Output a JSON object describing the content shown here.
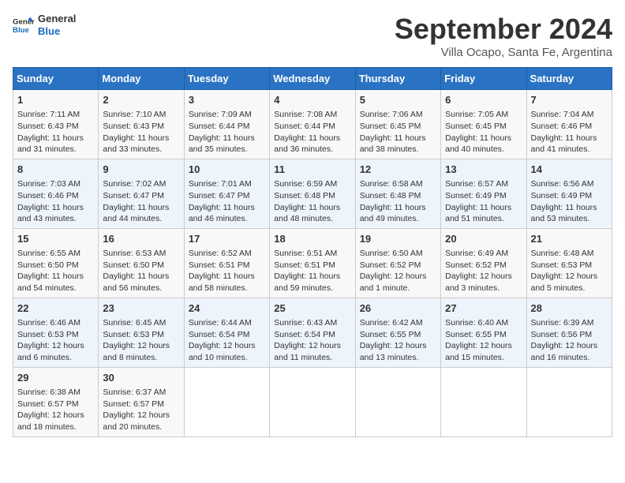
{
  "header": {
    "logo_line1": "General",
    "logo_line2": "Blue",
    "month": "September 2024",
    "location": "Villa Ocapo, Santa Fe, Argentina"
  },
  "days_of_week": [
    "Sunday",
    "Monday",
    "Tuesday",
    "Wednesday",
    "Thursday",
    "Friday",
    "Saturday"
  ],
  "weeks": [
    [
      {
        "day": "1",
        "info": "Sunrise: 7:11 AM\nSunset: 6:43 PM\nDaylight: 11 hours\nand 31 minutes."
      },
      {
        "day": "2",
        "info": "Sunrise: 7:10 AM\nSunset: 6:43 PM\nDaylight: 11 hours\nand 33 minutes."
      },
      {
        "day": "3",
        "info": "Sunrise: 7:09 AM\nSunset: 6:44 PM\nDaylight: 11 hours\nand 35 minutes."
      },
      {
        "day": "4",
        "info": "Sunrise: 7:08 AM\nSunset: 6:44 PM\nDaylight: 11 hours\nand 36 minutes."
      },
      {
        "day": "5",
        "info": "Sunrise: 7:06 AM\nSunset: 6:45 PM\nDaylight: 11 hours\nand 38 minutes."
      },
      {
        "day": "6",
        "info": "Sunrise: 7:05 AM\nSunset: 6:45 PM\nDaylight: 11 hours\nand 40 minutes."
      },
      {
        "day": "7",
        "info": "Sunrise: 7:04 AM\nSunset: 6:46 PM\nDaylight: 11 hours\nand 41 minutes."
      }
    ],
    [
      {
        "day": "8",
        "info": "Sunrise: 7:03 AM\nSunset: 6:46 PM\nDaylight: 11 hours\nand 43 minutes."
      },
      {
        "day": "9",
        "info": "Sunrise: 7:02 AM\nSunset: 6:47 PM\nDaylight: 11 hours\nand 44 minutes."
      },
      {
        "day": "10",
        "info": "Sunrise: 7:01 AM\nSunset: 6:47 PM\nDaylight: 11 hours\nand 46 minutes."
      },
      {
        "day": "11",
        "info": "Sunrise: 6:59 AM\nSunset: 6:48 PM\nDaylight: 11 hours\nand 48 minutes."
      },
      {
        "day": "12",
        "info": "Sunrise: 6:58 AM\nSunset: 6:48 PM\nDaylight: 11 hours\nand 49 minutes."
      },
      {
        "day": "13",
        "info": "Sunrise: 6:57 AM\nSunset: 6:49 PM\nDaylight: 11 hours\nand 51 minutes."
      },
      {
        "day": "14",
        "info": "Sunrise: 6:56 AM\nSunset: 6:49 PM\nDaylight: 11 hours\nand 53 minutes."
      }
    ],
    [
      {
        "day": "15",
        "info": "Sunrise: 6:55 AM\nSunset: 6:50 PM\nDaylight: 11 hours\nand 54 minutes."
      },
      {
        "day": "16",
        "info": "Sunrise: 6:53 AM\nSunset: 6:50 PM\nDaylight: 11 hours\nand 56 minutes."
      },
      {
        "day": "17",
        "info": "Sunrise: 6:52 AM\nSunset: 6:51 PM\nDaylight: 11 hours\nand 58 minutes."
      },
      {
        "day": "18",
        "info": "Sunrise: 6:51 AM\nSunset: 6:51 PM\nDaylight: 11 hours\nand 59 minutes."
      },
      {
        "day": "19",
        "info": "Sunrise: 6:50 AM\nSunset: 6:52 PM\nDaylight: 12 hours\nand 1 minute."
      },
      {
        "day": "20",
        "info": "Sunrise: 6:49 AM\nSunset: 6:52 PM\nDaylight: 12 hours\nand 3 minutes."
      },
      {
        "day": "21",
        "info": "Sunrise: 6:48 AM\nSunset: 6:53 PM\nDaylight: 12 hours\nand 5 minutes."
      }
    ],
    [
      {
        "day": "22",
        "info": "Sunrise: 6:46 AM\nSunset: 6:53 PM\nDaylight: 12 hours\nand 6 minutes."
      },
      {
        "day": "23",
        "info": "Sunrise: 6:45 AM\nSunset: 6:53 PM\nDaylight: 12 hours\nand 8 minutes."
      },
      {
        "day": "24",
        "info": "Sunrise: 6:44 AM\nSunset: 6:54 PM\nDaylight: 12 hours\nand 10 minutes."
      },
      {
        "day": "25",
        "info": "Sunrise: 6:43 AM\nSunset: 6:54 PM\nDaylight: 12 hours\nand 11 minutes."
      },
      {
        "day": "26",
        "info": "Sunrise: 6:42 AM\nSunset: 6:55 PM\nDaylight: 12 hours\nand 13 minutes."
      },
      {
        "day": "27",
        "info": "Sunrise: 6:40 AM\nSunset: 6:55 PM\nDaylight: 12 hours\nand 15 minutes."
      },
      {
        "day": "28",
        "info": "Sunrise: 6:39 AM\nSunset: 6:56 PM\nDaylight: 12 hours\nand 16 minutes."
      }
    ],
    [
      {
        "day": "29",
        "info": "Sunrise: 6:38 AM\nSunset: 6:57 PM\nDaylight: 12 hours\nand 18 minutes."
      },
      {
        "day": "30",
        "info": "Sunrise: 6:37 AM\nSunset: 6:57 PM\nDaylight: 12 hours\nand 20 minutes."
      },
      {
        "day": "",
        "info": ""
      },
      {
        "day": "",
        "info": ""
      },
      {
        "day": "",
        "info": ""
      },
      {
        "day": "",
        "info": ""
      },
      {
        "day": "",
        "info": ""
      }
    ]
  ]
}
